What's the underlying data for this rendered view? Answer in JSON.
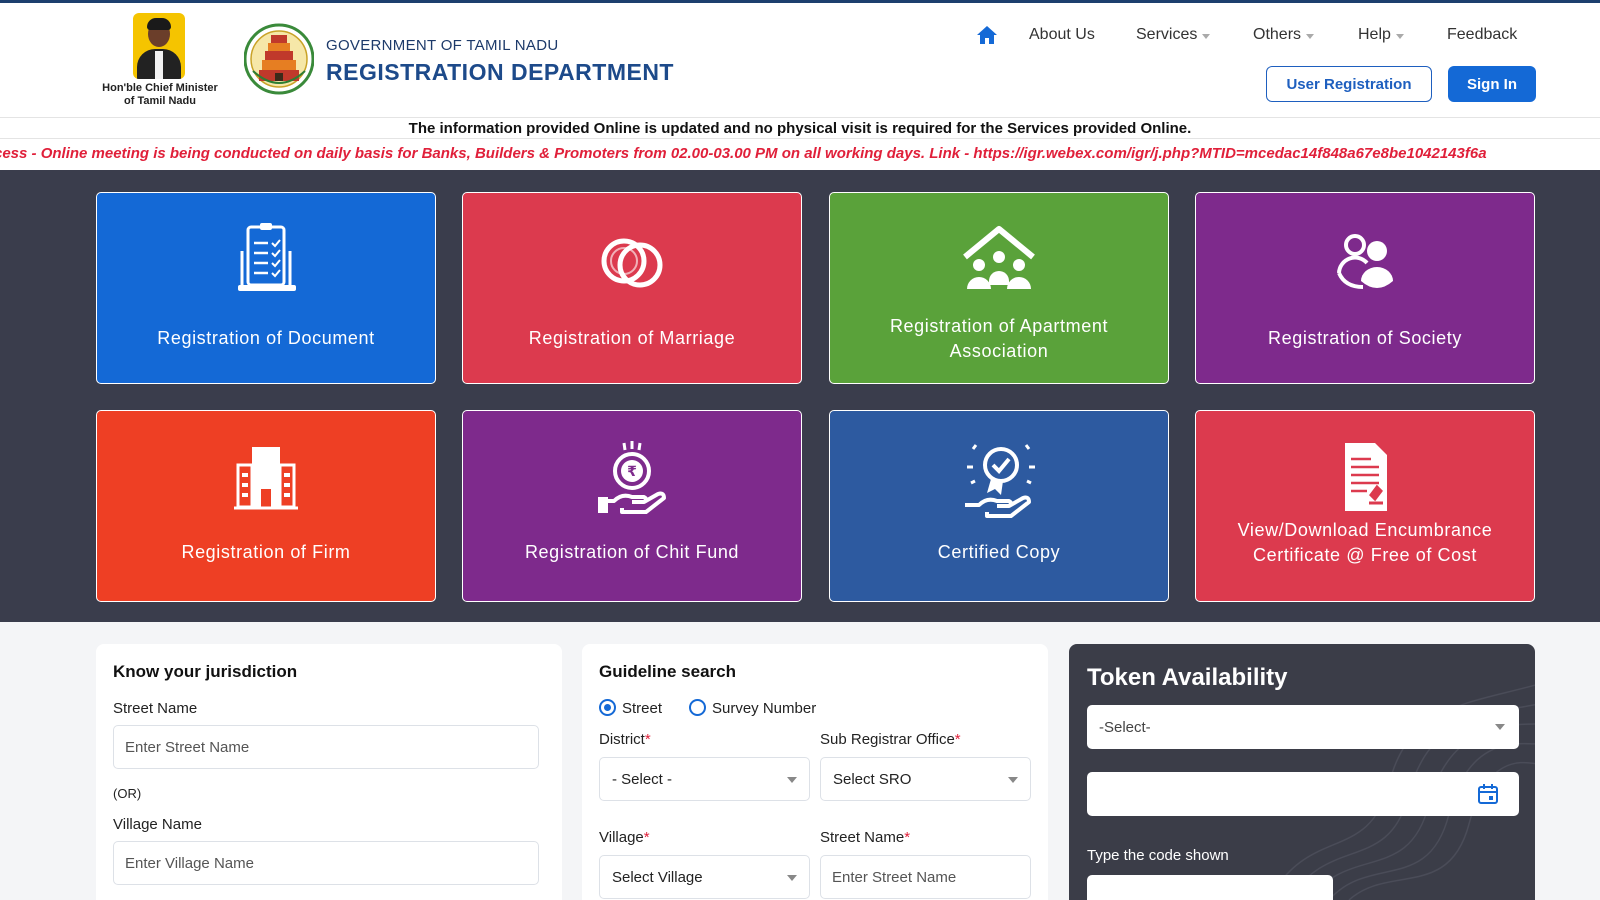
{
  "header": {
    "cm_caption": "Hon'ble Chief Minister\nof Tamil Nadu",
    "govt_name": "GOVERNMENT OF TAMIL NADU",
    "dept_name": "REGISTRATION DEPARTMENT",
    "nav": {
      "about": "About Us",
      "services": "Services",
      "others": "Others",
      "help": "Help",
      "feedback": "Feedback"
    },
    "user_registration": "User Registration",
    "sign_in": "Sign In"
  },
  "notice": "The information provided Online is updated and no physical visit is required for the Services provided Online.",
  "ticker": "cess - Online meeting is being conducted on daily basis for Banks, Builders & Promoters from 02.00-03.00 PM on all working days. Link - https://igr.webex.com/igr/j.php?MTID=mcedac14f848a67e8be1042143f6a",
  "tiles": [
    {
      "label": "Registration of Document",
      "icon": "document-checklist-icon",
      "color": "#1469d6"
    },
    {
      "label": "Registration of Marriage",
      "icon": "rings-icon",
      "color": "#dc3a4e"
    },
    {
      "label": "Registration of Apartment Association",
      "icon": "house-people-icon",
      "color": "#5aa23a"
    },
    {
      "label": "Registration of Society",
      "icon": "people-icon",
      "color": "#7e2a8c"
    },
    {
      "label": "Registration of Firm",
      "icon": "building-icon",
      "color": "#ee3f24"
    },
    {
      "label": "Registration of Chit Fund",
      "icon": "rupee-hand-icon",
      "color": "#7e2a8c"
    },
    {
      "label": "Certified Copy",
      "icon": "certificate-hand-icon",
      "color": "#2d5aa0"
    },
    {
      "label": "View/Download Encumbrance Certificate @ Free of Cost",
      "icon": "document-stamp-icon",
      "color": "#dc3a4e"
    }
  ],
  "jurisdiction": {
    "title": "Know your jurisdiction",
    "street_label": "Street Name",
    "street_placeholder": "Enter Street Name",
    "or": "(OR)",
    "village_label": "Village Name",
    "village_placeholder": "Enter Village Name"
  },
  "guideline": {
    "title": "Guideline search",
    "radio_street": "Street",
    "radio_survey": "Survey Number",
    "district_label": "District",
    "district_value": "- Select -",
    "sro_label": "Sub Registrar Office",
    "sro_value": "Select SRO",
    "village_label": "Village",
    "village_value": "Select Village",
    "street_label": "Street Name",
    "street_placeholder": "Enter Street Name",
    "required_mark": "*"
  },
  "token": {
    "title": "Token Availability",
    "select_value": "-Select-",
    "code_label": "Type the code shown"
  }
}
